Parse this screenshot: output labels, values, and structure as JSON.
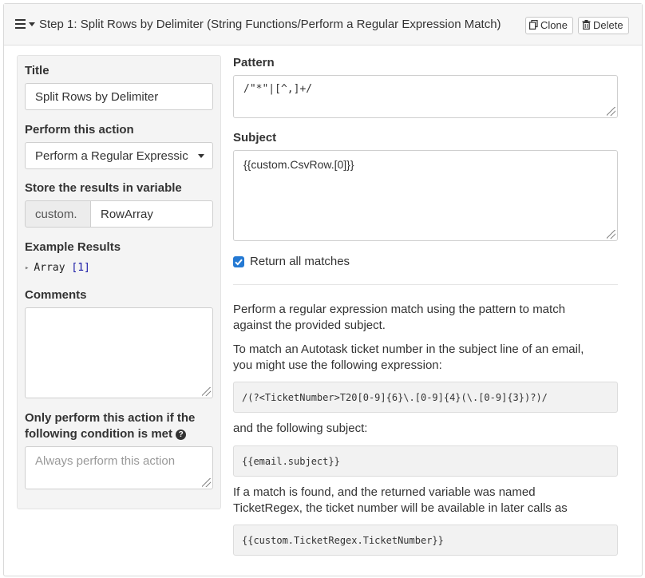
{
  "header": {
    "title": "Step 1: Split Rows by Delimiter (String Functions/Perform a Regular Expression Match)",
    "clone_label": "Clone",
    "delete_label": "Delete"
  },
  "left": {
    "title_label": "Title",
    "title_value": "Split Rows by Delimiter",
    "action_label": "Perform this action",
    "action_value": "Perform a Regular Expressic",
    "store_label": "Store the results in variable",
    "store_prefix": "custom.",
    "store_value": "RowArray",
    "example_label": "Example Results",
    "example_tree_key": "Array",
    "example_tree_count": "[1]",
    "comments_label": "Comments",
    "condition_label_line1": "Only perform this action if the",
    "condition_label_line2": "following condition is met",
    "condition_placeholder": "Always perform this action"
  },
  "right": {
    "pattern_label": "Pattern",
    "pattern_value": "/\"*\"|[^,]+/",
    "subject_label": "Subject",
    "subject_value": "{{custom.CsvRow.[0]}}",
    "return_all_label": "Return all matches",
    "return_all_checked": true,
    "desc1_line1": "Perform a regular expression match using the pattern to match",
    "desc1_line2": "against the provided subject.",
    "desc2_line1": "To match an Autotask ticket number in the subject line of an email,",
    "desc2_line2": "you might use the following expression:",
    "code1": "/(?<TicketNumber>T20[0-9]{6}\\.[0-9]{4}(\\.[0-9]{3})?)/",
    "desc3": "and the following subject:",
    "code2": "{{email.subject}}",
    "desc4_line1": "If a match is found, and the returned variable was named",
    "desc4_line2": "TicketRegex, the ticket number will be available in later calls as",
    "code3": "{{custom.TicketRegex.TicketNumber}}"
  },
  "colors": {
    "accent": "#2479d3",
    "well_bg": "#f4f4f4",
    "code_bg": "#f2f2f2"
  },
  "icons": [
    "hamburger-icon",
    "chevron-down-icon",
    "clone-icon",
    "trash-icon",
    "question-circle-icon",
    "resize-grip-icon",
    "checkbox-icon"
  ]
}
